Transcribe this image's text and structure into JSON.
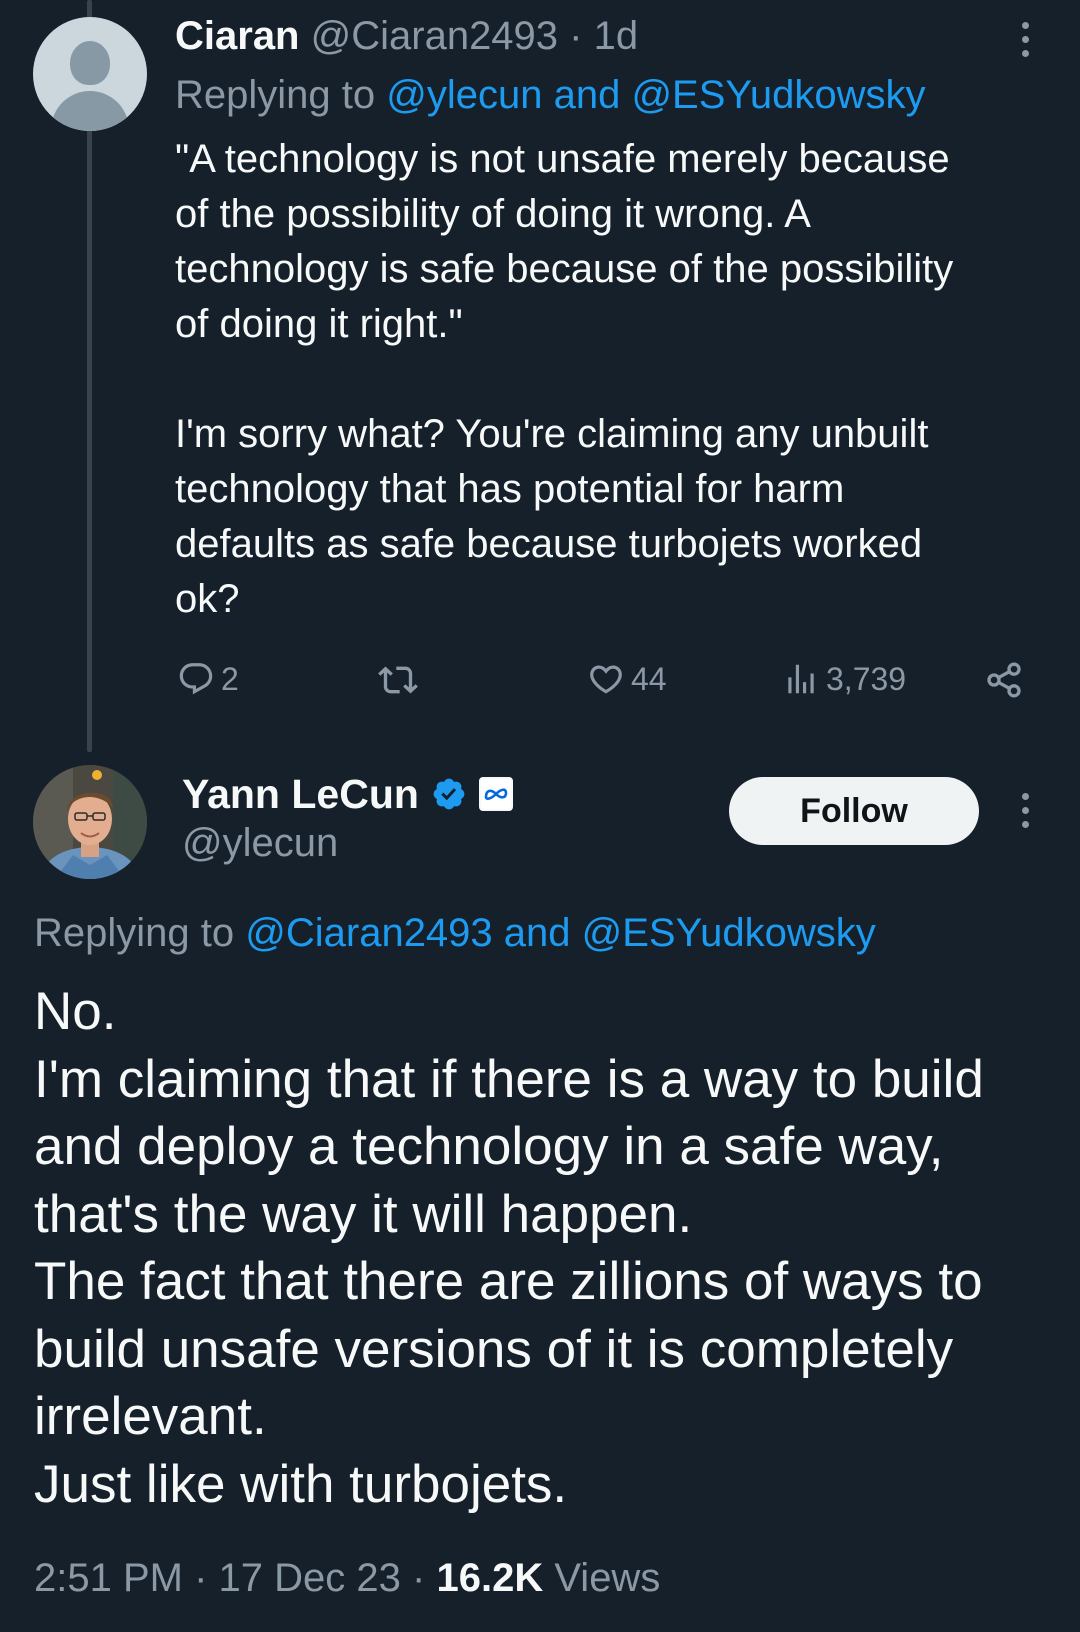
{
  "reply_tweet": {
    "author_name": "Ciaran",
    "author_handle": "@Ciaran2493",
    "separator": "·",
    "time_ago": "1d",
    "replying_prefix": "Replying to",
    "replying_to": "@ylecun and @ESYudkowsky",
    "text_lines": [
      "\"A technology is not unsafe merely because",
      "of the possibility of doing it wrong. A",
      "technology is safe because of the possibility",
      "of doing it right.\"",
      "",
      "I'm sorry what?  You're claiming any unbuilt",
      "technology that has potential for harm",
      "defaults as safe because turbojets worked",
      "ok?"
    ],
    "actions": {
      "replies": "2",
      "retweets": "",
      "likes": "44",
      "views": "3,739"
    }
  },
  "main_tweet": {
    "author_name": "Yann LeCun",
    "author_handle": "@ylecun",
    "follow_label": "Follow",
    "replying_prefix": "Replying to",
    "replying_to": "@Ciaran2493 and @ESYudkowsky",
    "text_lines": [
      "No.",
      "I'm claiming that if there is a way to build",
      "and deploy a technology in a safe way,",
      "that's the way it will happen.",
      "The fact that there are zillions of ways to",
      "build unsafe versions of it is completely",
      "irrelevant.",
      "Just like with turbojets."
    ],
    "time": "2:51 PM",
    "separator": "·",
    "date": "17 Dec 23",
    "views_count": "16.2K",
    "views_label": "Views"
  },
  "icons": {
    "verified": "verified-badge-icon",
    "affiliation": "meta-logo-icon",
    "reply": "reply-icon",
    "retweet": "retweet-icon",
    "like": "heart-icon",
    "views": "views-bar-icon",
    "share": "share-icon",
    "more": "more-kebab-icon"
  },
  "colors": {
    "background": "#15202b",
    "text": "#f7f9f9",
    "muted": "#8b98a5",
    "link": "#1d9bf0",
    "verified": "#1d9bf0"
  }
}
